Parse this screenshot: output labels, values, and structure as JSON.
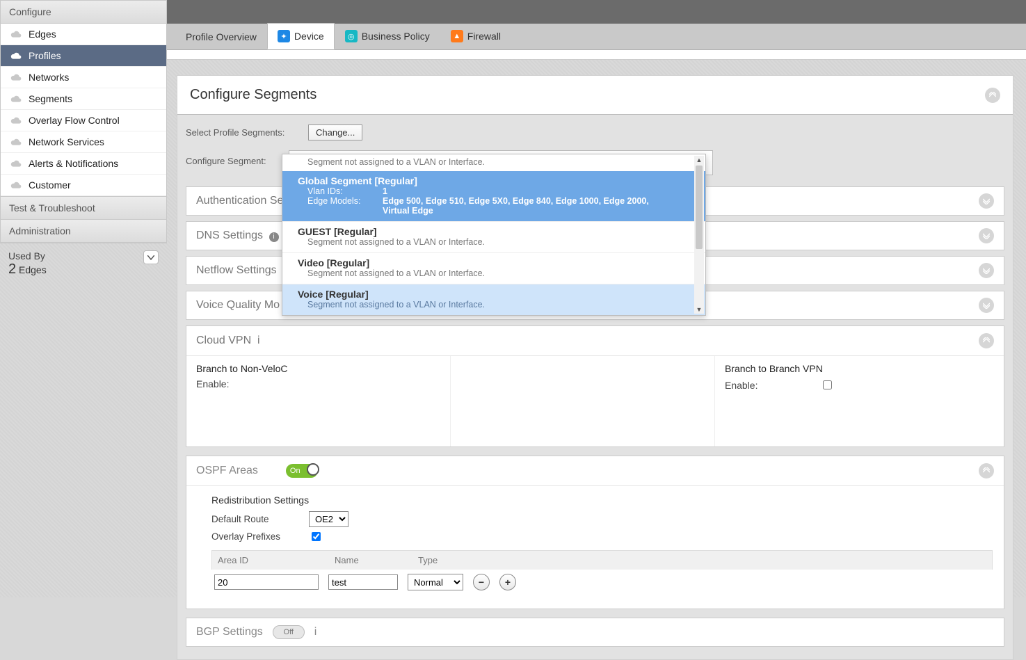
{
  "sidebar": {
    "configure_label": "Configure",
    "items": [
      {
        "label": "Edges"
      },
      {
        "label": "Profiles"
      },
      {
        "label": "Networks"
      },
      {
        "label": "Segments"
      },
      {
        "label": "Overlay Flow Control"
      },
      {
        "label": "Network Services"
      },
      {
        "label": "Alerts & Notifications"
      },
      {
        "label": "Customer"
      }
    ],
    "test_label": "Test & Troubleshoot",
    "admin_label": "Administration",
    "used_by_label": "Used By",
    "used_by_count": "2",
    "used_by_unit": "Edges"
  },
  "tabs": {
    "overview": "Profile Overview",
    "device": "Device",
    "business": "Business Policy",
    "firewall": "Firewall"
  },
  "segments_panel": {
    "title": "Configure Segments",
    "select_profile_label": "Select Profile Segments:",
    "change_btn": "Change...",
    "configure_label": "Configure Segment:",
    "selected": "Global Segment [Regular]",
    "top_note": "Segment not assigned to a VLAN or Interface.",
    "dropdown": [
      {
        "title": "Global Segment [Regular]",
        "vlan_k": "Vlan IDs:",
        "vlan_v": "1",
        "models_k": "Edge Models:",
        "models_v": "Edge 500, Edge 510, Edge 5X0, Edge 840, Edge 1000, Edge 2000, Virtual Edge"
      },
      {
        "title": "GUEST [Regular]",
        "sub": "Segment not assigned to a VLAN or Interface."
      },
      {
        "title": "Video [Regular]",
        "sub": "Segment not assigned to a VLAN or Interface."
      },
      {
        "title": "Voice [Regular]",
        "sub": "Segment not assigned to a VLAN or Interface."
      }
    ]
  },
  "accordions": {
    "auth": "Authentication Se",
    "dns": "DNS Settings",
    "netflow": "Netflow Settings",
    "voice": "Voice Quality Mo"
  },
  "cloudvpn": {
    "title": "Cloud VPN",
    "col1_title": "Branch to Non-VeloC",
    "enable_label": "Enable:",
    "col3_title": "Branch to Branch VPN"
  },
  "ospf": {
    "title": "OSPF Areas",
    "toggle": "On",
    "redist": "Redistribution Settings",
    "default_route": "Default Route",
    "default_route_val": "OE2",
    "overlay": "Overlay Prefixes",
    "col_area": "Area ID",
    "col_name": "Name",
    "col_type": "Type",
    "row_area": "20",
    "row_name": "test",
    "row_type": "Normal"
  },
  "bgp": {
    "title": "BGP Settings",
    "toggle": "Off"
  }
}
